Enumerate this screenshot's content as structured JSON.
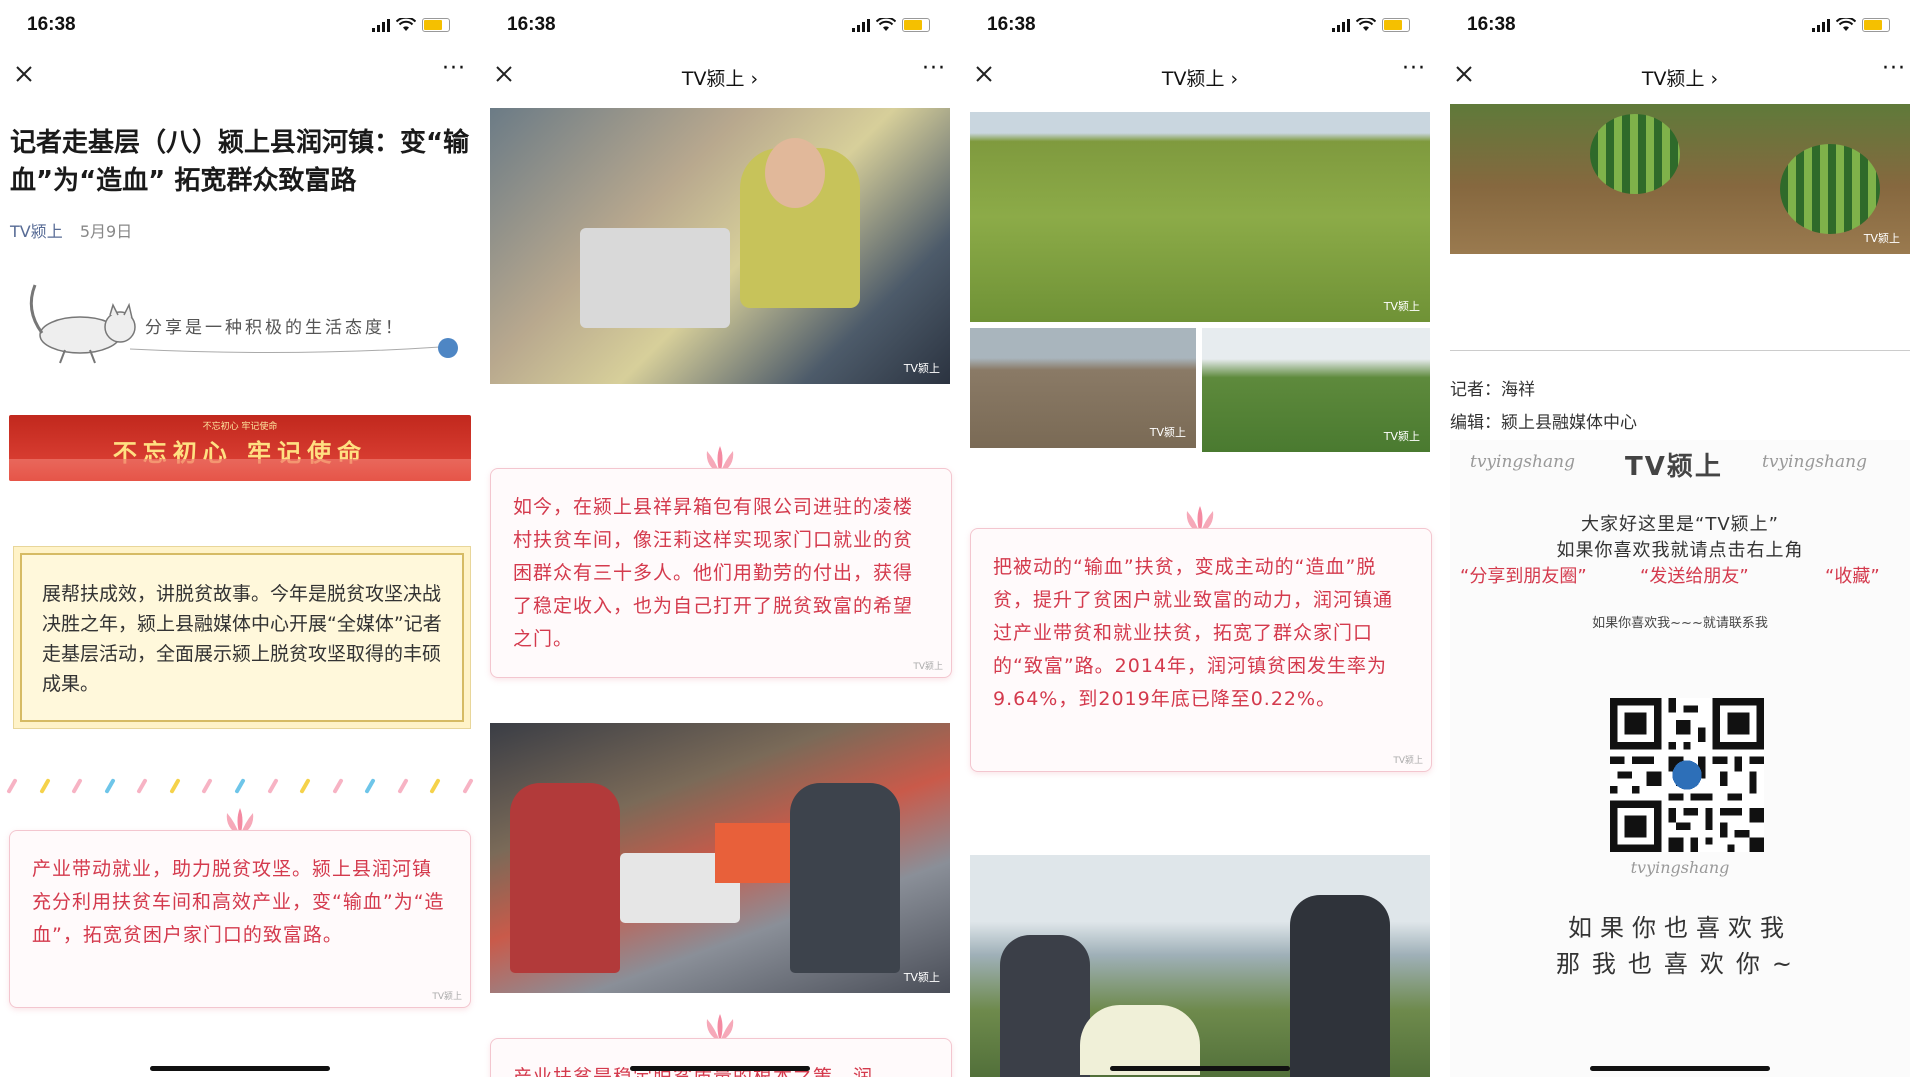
{
  "status": {
    "time": "16:38"
  },
  "screen1": {
    "title": "记者走基层（八）颍上县润河镇：变“输血”为“造血” 拓宽群众致富路",
    "source": "TV颍上",
    "date": "5月9日",
    "cat_text": "分享是一种积极的生活态度！",
    "banner_small": "不忘初心 牢记使命",
    "banner_big": "不忘初心  牢记使命",
    "intro": "展帮扶成效，讲脱贫故事。今年是脱贫攻坚决战决胜之年，颍上县融媒体中心开展“全媒体”记者走基层活动，全面展示颍上脱贫攻坚取得的丰硕成果。",
    "para1": "产业带动就业，助力脱贫攻坚。颍上县润河镇充分利用扶贫车间和高效产业，变“输血”为“造血”，拓宽贫困户家门口的致富路。",
    "wm": "TV颍上"
  },
  "screen2": {
    "nav_title": "TV颍上 ›",
    "para": "如今，在颍上县祥昇箱包有限公司进驻的凌楼村扶贫车间，像汪莉这样实现家门口就业的贫困群众有三十多人。他们用勤劳的付出，获得了稳定收入，也为自己打开了脱贫致富的希望之门。",
    "bottom_text": "产业扶贫是稳定脱贫质量的根本之策，润",
    "wm": "TV颍上"
  },
  "screen3": {
    "nav_title": "TV颍上 ›",
    "para": "把被动的“输血”扶贫，变成主动的“造血”脱贫，提升了贫困户就业致富的动力，润河镇通过产业带贫和就业扶贫，拓宽了群众家门口的“致富”路。2014年，润河镇贫困发生率为9.64%，到2019年底已降至0.22%。",
    "wm": "TV颍上"
  },
  "screen4": {
    "nav_title": "TV颍上 ›",
    "reporter": "记者：海祥",
    "editor": "编辑：颍上县融媒体中心",
    "brand_script": "tvyingshang",
    "brand_name": "TV颍上",
    "promo1": "大家好这里是“TV颍上”",
    "promo2": "如果你喜欢我就请点击右上角",
    "promo3a": "“分享到朋友圈”",
    "promo3b": "“发送给朋友”",
    "promo3c": "“收藏”",
    "promo4": "如果你喜欢我~~~就请联系我",
    "qr_label": "tvyingshang",
    "closing1": "如果你也喜欢我",
    "closing2": "那我也喜欢你~",
    "wm": "TV颍上"
  },
  "colors": {
    "accent_red": "#d43a4d",
    "link_blue": "#576b95"
  }
}
